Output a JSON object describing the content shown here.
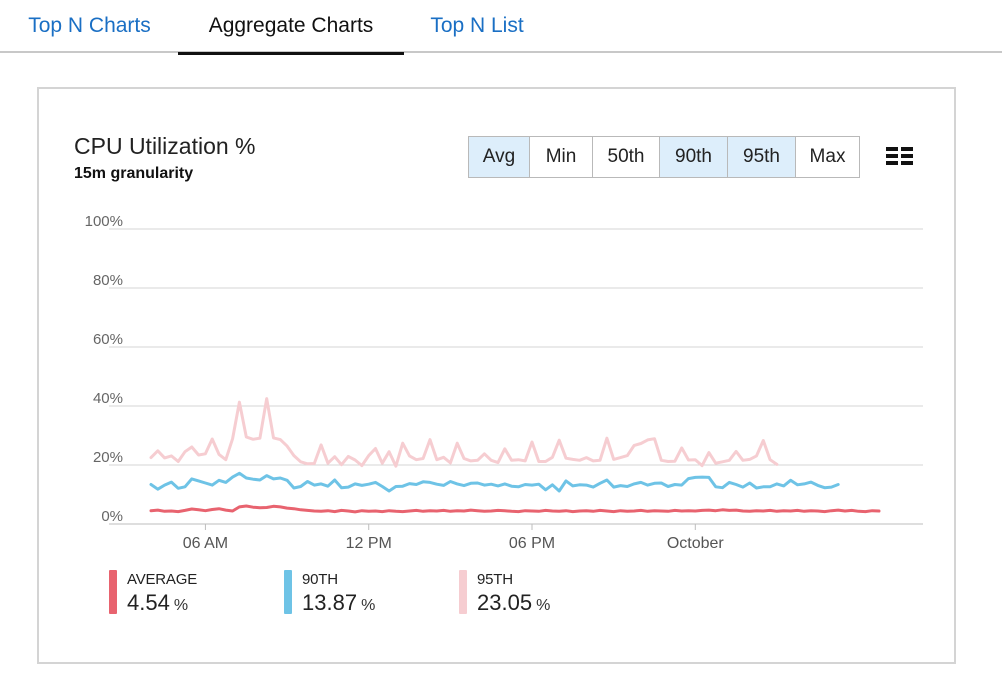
{
  "tabs": [
    {
      "label": "Top N Charts",
      "active": false
    },
    {
      "label": "Aggregate Charts",
      "active": true
    },
    {
      "label": "Top N List",
      "active": false
    }
  ],
  "card": {
    "title": "CPU Utilization %",
    "subtitle": "15m granularity",
    "aggregations": [
      {
        "label": "Avg",
        "selected": true
      },
      {
        "label": "Min",
        "selected": false
      },
      {
        "label": "50th",
        "selected": false
      },
      {
        "label": "90th",
        "selected": true
      },
      {
        "label": "95th",
        "selected": true
      },
      {
        "label": "Max",
        "selected": false
      }
    ],
    "menu_icon": "list-view-icon"
  },
  "colors": {
    "tab_link": "#1a6fc4",
    "average": "#e8636f",
    "p90": "#6ec3e6",
    "p95": "#f6cdd1",
    "selected_button": "#ddeefb",
    "grid": "#d0d0d0"
  },
  "legend": [
    {
      "name": "AVERAGE",
      "value": "4.54",
      "unit": "%",
      "color": "#e8636f"
    },
    {
      "name": "90TH",
      "value": "13.87",
      "unit": "%",
      "color": "#6ec3e6"
    },
    {
      "name": "95TH",
      "value": "23.05",
      "unit": "%",
      "color": "#f6cdd1"
    }
  ],
  "chart_data": {
    "type": "line",
    "title": "CPU Utilization %",
    "subtitle": "15m granularity",
    "ylim": [
      0,
      100
    ],
    "y_ticks": [
      "0%",
      "20%",
      "40%",
      "60%",
      "80%",
      "100%"
    ],
    "x_ticks": [
      "06 AM",
      "12 PM",
      "06 PM",
      "October"
    ],
    "x_tick_index": [
      8,
      32,
      56,
      80
    ],
    "grid": true,
    "legend_position": "bottom-left",
    "series": [
      {
        "name": "AVERAGE",
        "color": "#e8636f",
        "values": [
          4.5,
          4.7,
          4.3,
          4.4,
          4.2,
          4.6,
          5.1,
          4.8,
          4.5,
          4.9,
          5.2,
          4.7,
          4.4,
          5.8,
          6.1,
          5.7,
          5.5,
          5.6,
          6.0,
          5.8,
          5.4,
          5.2,
          4.8,
          4.6,
          4.4,
          4.3,
          4.5,
          4.2,
          4.6,
          4.4,
          4.1,
          4.5,
          4.3,
          4.4,
          4.2,
          4.5,
          4.3,
          4.2,
          4.4,
          4.6,
          4.3,
          4.5,
          4.4,
          4.6,
          4.3,
          4.5,
          4.4,
          4.7,
          4.5,
          4.3,
          4.4,
          4.6,
          4.5,
          4.3,
          4.2,
          4.5,
          4.4,
          4.3,
          4.6,
          4.4,
          4.3,
          4.5,
          4.2,
          4.4,
          4.5,
          4.3,
          4.6,
          4.4,
          4.2,
          4.5,
          4.3,
          4.4,
          4.6,
          4.3,
          4.5,
          4.4,
          4.3,
          4.6,
          4.4,
          4.5,
          4.4,
          4.6,
          4.7,
          4.5,
          4.8,
          4.6,
          4.7,
          4.4,
          4.3,
          4.5,
          4.4,
          4.6,
          4.3,
          4.5,
          4.4,
          4.6,
          4.3,
          4.5,
          4.4,
          4.2,
          4.5,
          4.7,
          4.4,
          4.6,
          4.3,
          4.2,
          4.5,
          4.4
        ]
      },
      {
        "name": "90TH",
        "color": "#6ec3e6",
        "values": [
          13.4,
          11.8,
          13.2,
          14.2,
          12.1,
          12.6,
          15.3,
          14.6,
          13.9,
          13.2,
          14.8,
          14.1,
          15.9,
          17.2,
          15.6,
          15.2,
          14.9,
          16.4,
          15.3,
          15.6,
          14.8,
          12.2,
          12.7,
          14.4,
          13.2,
          13.6,
          12.8,
          14.9,
          12.3,
          12.5,
          13.6,
          13.1,
          13.5,
          14.1,
          12.7,
          11.2,
          12.7,
          12.8,
          13.7,
          13.4,
          14.3,
          14.1,
          13.5,
          13.1,
          14.4,
          13.6,
          13.0,
          13.8,
          13.9,
          13.2,
          13.5,
          12.9,
          13.6,
          12.8,
          12.6,
          13.4,
          13.2,
          13.5,
          11.6,
          13.3,
          11.2,
          14.6,
          12.9,
          13.3,
          13.2,
          12.5,
          13.8,
          14.9,
          12.5,
          13.0,
          12.7,
          13.6,
          14.1,
          13.2,
          13.8,
          13.9,
          12.7,
          13.4,
          13.2,
          15.4,
          15.8,
          15.9,
          15.8,
          12.6,
          12.3,
          14.1,
          13.4,
          12.5,
          13.9,
          12.2,
          12.6,
          12.6,
          13.6,
          12.9,
          14.8,
          13.3,
          13.6,
          14.2,
          13.1,
          12.3,
          12.5,
          13.4
        ]
      },
      {
        "name": "95TH",
        "color": "#f6cdd1",
        "values": [
          22.5,
          24.8,
          22.4,
          23.1,
          21.2,
          24.5,
          26.1,
          23.4,
          23.8,
          28.8,
          23.6,
          21.8,
          28.9,
          41.3,
          29.5,
          28.7,
          29.1,
          42.5,
          29.2,
          28.6,
          26.4,
          23.2,
          21.1,
          20.4,
          20.5,
          26.8,
          20.6,
          22.8,
          20.1,
          22.9,
          21.7,
          19.8,
          23.2,
          25.6,
          20.6,
          24.5,
          19.6,
          27.4,
          23.1,
          21.8,
          22.2,
          28.6,
          21.8,
          22.6,
          20.7,
          27.4,
          22.2,
          21.4,
          21.6,
          23.8,
          21.6,
          20.8,
          25.5,
          21.6,
          21.8,
          21.4,
          27.8,
          21.2,
          21.2,
          22.6,
          28.4,
          22.3,
          21.9,
          21.6,
          22.5,
          21.4,
          21.6,
          29.1,
          21.9,
          22.5,
          23.2,
          26.6,
          27.3,
          28.5,
          28.9,
          21.6,
          21.2,
          21.3,
          25.8,
          21.7,
          21.8,
          19.8,
          24.2,
          20.6,
          21.1,
          21.6,
          24.6,
          21.6,
          21.9,
          23.1,
          28.3,
          21.8,
          20.2
        ]
      }
    ]
  }
}
